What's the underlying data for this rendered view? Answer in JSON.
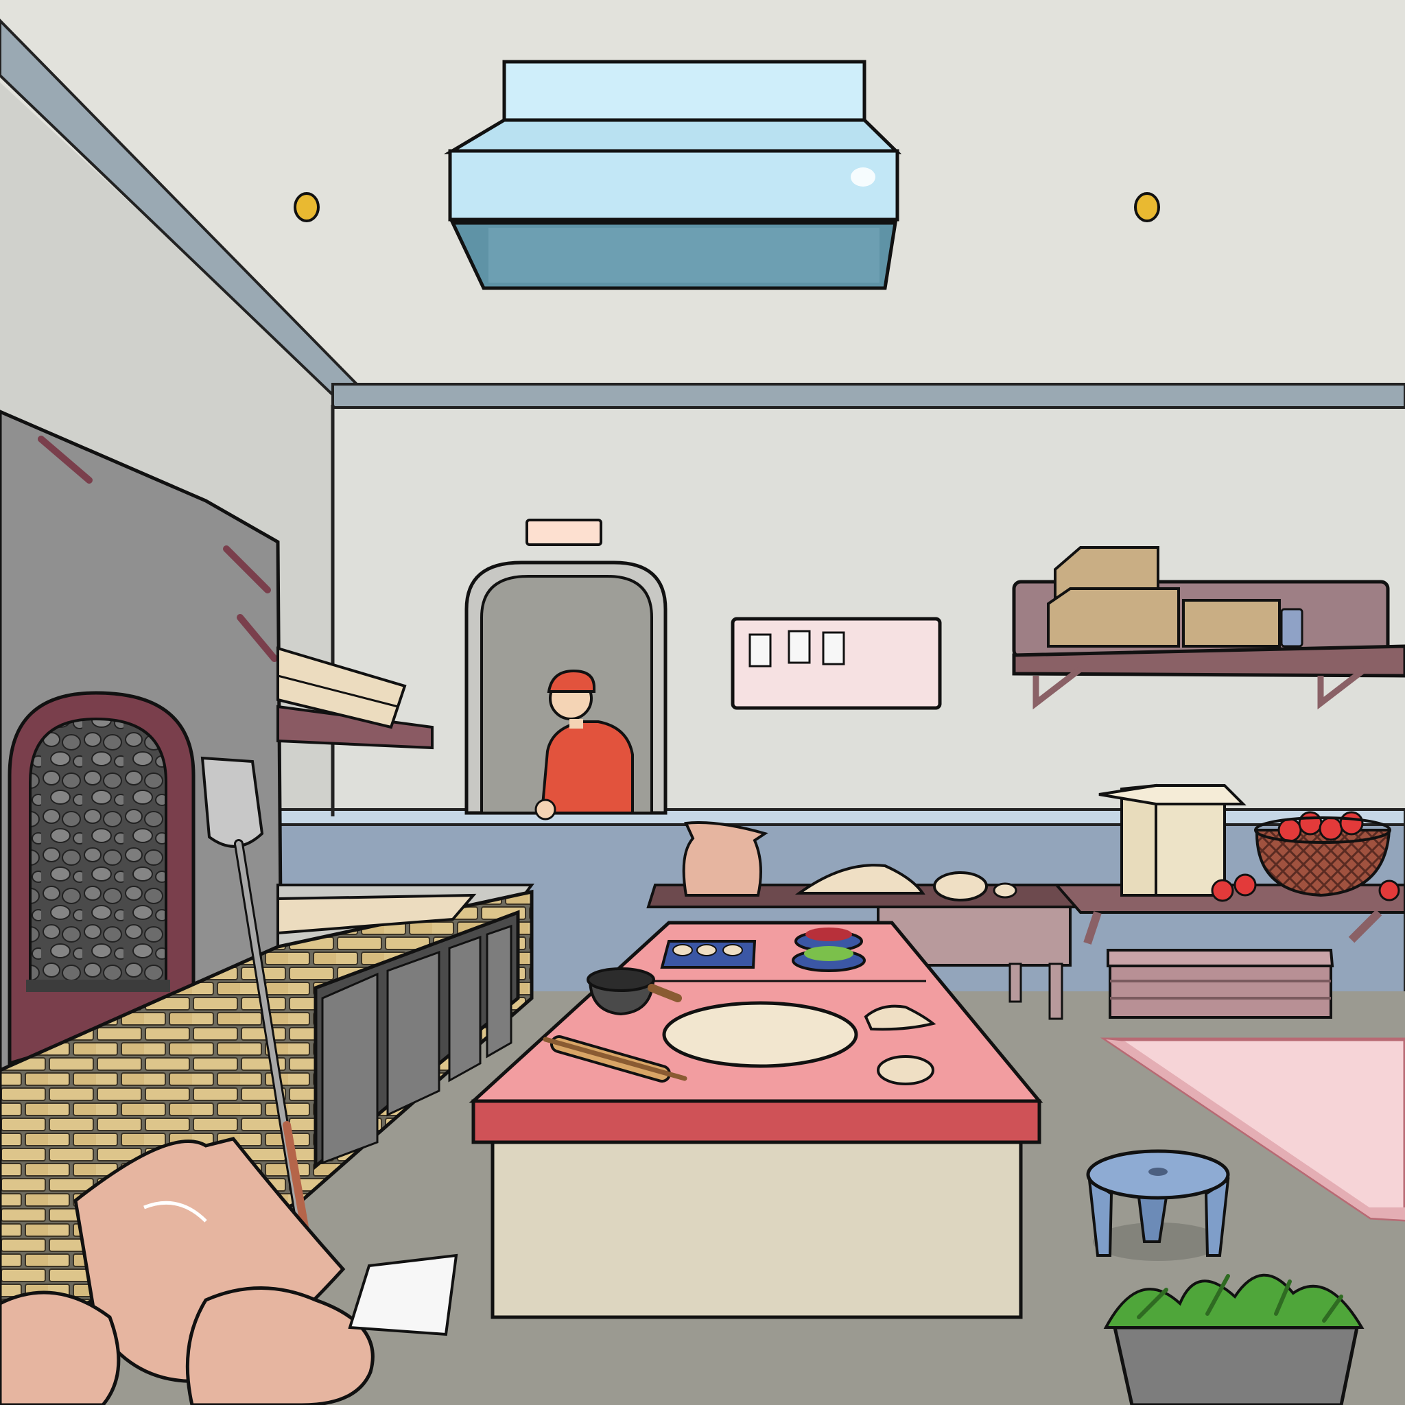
{
  "scene": {
    "setting": "pizzeria-kitchen",
    "colors": {
      "ceiling": "#e2e2dc",
      "wall": "#dedfda",
      "left_wall": "#d3d4cf",
      "wainscot": "#93a5bb",
      "floor": "#9b9a91",
      "table_top": "#f29da0",
      "table_edge": "#cf5257",
      "table_base": "#ddd6c0",
      "hood": "#cfeefa",
      "brick_tan": "#ddc58b",
      "brick_dark": "#7a3f4c",
      "shelf": "#8a6166",
      "box": "#c9ae84",
      "sack": "#e6b5a0",
      "stool": "#7f9ec9",
      "plant": "#4fa63a",
      "chef_uniform": "#e2533d",
      "mat": "#f6d4d7"
    },
    "objects": [
      {
        "name": "range-hood"
      },
      {
        "name": "ceiling-light-left"
      },
      {
        "name": "ceiling-light-right"
      },
      {
        "name": "pizza-oven"
      },
      {
        "name": "pizza-peel"
      },
      {
        "name": "chef"
      },
      {
        "name": "doorway"
      },
      {
        "name": "notice-board"
      },
      {
        "name": "wall-shelf"
      },
      {
        "name": "dough-table"
      },
      {
        "name": "flour-sack"
      },
      {
        "name": "ingredient-bowls"
      },
      {
        "name": "dough-tray"
      },
      {
        "name": "saucepan"
      },
      {
        "name": "rolling-pin"
      },
      {
        "name": "pizza-dough"
      },
      {
        "name": "prep-table"
      },
      {
        "name": "cardboard-box"
      },
      {
        "name": "tomato-basket"
      },
      {
        "name": "storage-crate"
      },
      {
        "name": "floor-mat"
      },
      {
        "name": "stool"
      },
      {
        "name": "greens-bucket"
      },
      {
        "name": "flour-sacks-pile"
      },
      {
        "name": "paper-note"
      },
      {
        "name": "lumber-stack"
      },
      {
        "name": "counter-cabinets"
      }
    ]
  }
}
